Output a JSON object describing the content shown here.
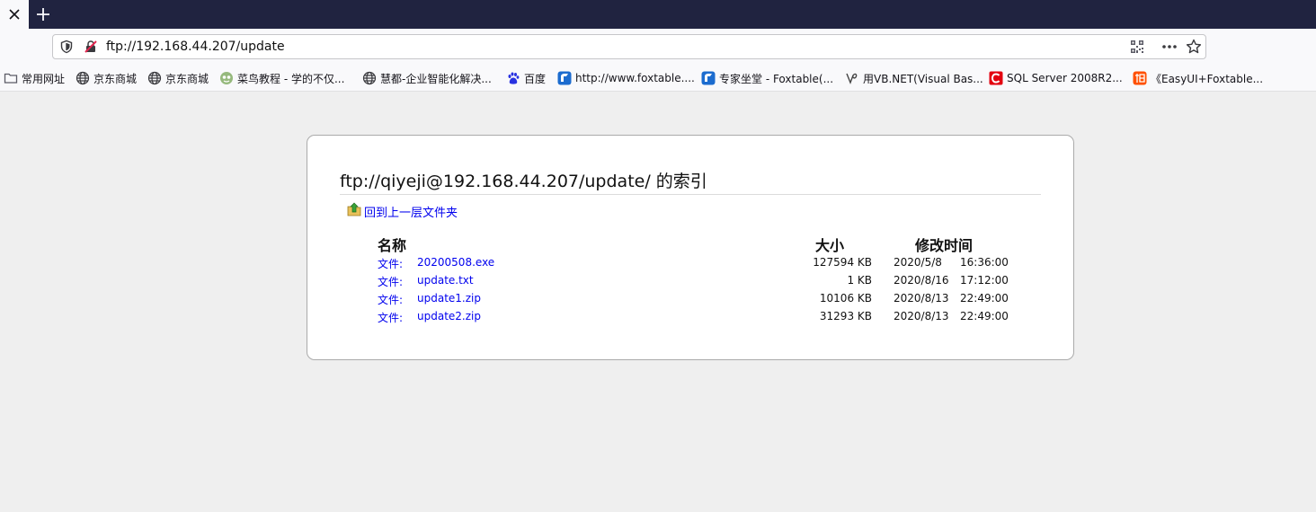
{
  "browser": {
    "new_tab_symbol": "+",
    "url": "ftp://192.168.44.207/update",
    "bookmarks": [
      {
        "label": "常用网址",
        "icon": "folder-icon"
      },
      {
        "label": "京东商城",
        "icon": "globe-icon"
      },
      {
        "label": "京东商城",
        "icon": "globe-icon"
      },
      {
        "label": "菜鸟教程 - 学的不仅...",
        "icon": "runoob-icon"
      },
      {
        "label": "慧都-企业智能化解决...",
        "icon": "globe-icon"
      },
      {
        "label": "百度",
        "icon": "baidu-paw-icon"
      },
      {
        "label": "http://www.foxtable....",
        "icon": "foxtable-icon"
      },
      {
        "label": "专家坐堂 - Foxtable(...",
        "icon": "foxtable-icon"
      },
      {
        "label": "用VB.NET(Visual Bas...",
        "icon": "vb-icon"
      },
      {
        "label": "SQL Server 2008R2...",
        "icon": "csdn-icon"
      },
      {
        "label": "《EasyUI+Foxtable...",
        "icon": "taobao-icon"
      }
    ]
  },
  "index": {
    "title": "ftp://qiyeji@192.168.44.207/update/ 的索引",
    "up_link": "回到上一层文件夹",
    "columns": {
      "name": "名称",
      "size": "大小",
      "modified": "修改时间"
    },
    "files": [
      {
        "type": "文件:",
        "name": "20200508.exe",
        "size": "127594 KB",
        "date": "2020/5/8",
        "time": "16:36:00"
      },
      {
        "type": "文件:",
        "name": "update.txt",
        "size": "1 KB",
        "date": "2020/8/16",
        "time": "17:12:00"
      },
      {
        "type": "文件:",
        "name": "update1.zip",
        "size": "10106 KB",
        "date": "2020/8/13",
        "time": "22:49:00"
      },
      {
        "type": "文件:",
        "name": "update2.zip",
        "size": "31293 KB",
        "date": "2020/8/13",
        "time": "22:49:00"
      }
    ]
  },
  "colors": {
    "tabstrip": "#202340",
    "link": "#0000ee",
    "page_bg": "#efefef"
  }
}
